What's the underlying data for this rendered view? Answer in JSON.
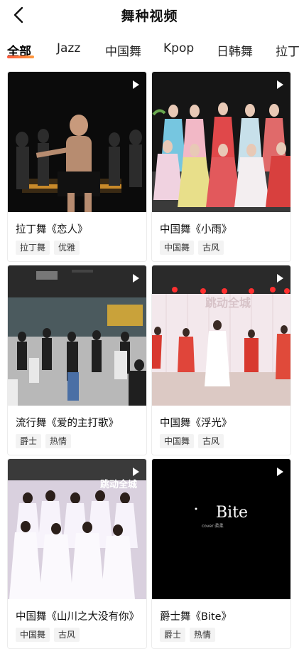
{
  "header": {
    "title": "舞种视频"
  },
  "tabs": [
    "全部",
    "Jazz",
    "中国舞",
    "Kpop",
    "日韩舞",
    "拉丁"
  ],
  "active_tab": 0,
  "cards": [
    {
      "title": "拉丁舞《恋人》",
      "tags": [
        "拉丁舞",
        "优雅"
      ]
    },
    {
      "title": "中国舞《小雨》",
      "tags": [
        "中国舞",
        "古风"
      ]
    },
    {
      "title": "流行舞《爱的主打歌》",
      "tags": [
        "爵士",
        "热情"
      ]
    },
    {
      "title": "中国舞《浮光》",
      "tags": [
        "中国舞",
        "古风"
      ]
    },
    {
      "title": "中国舞《山川之大没有你》",
      "tags": [
        "中国舞",
        "古风"
      ]
    },
    {
      "title": "爵士舞《Bite》",
      "tags": [
        "爵士",
        "热情"
      ]
    }
  ],
  "overlays": {
    "card4_watermark": "跳动全城",
    "card5_watermark": "跳动全城",
    "card6_text": "Bite",
    "card6_small": "cover:柔柔"
  }
}
